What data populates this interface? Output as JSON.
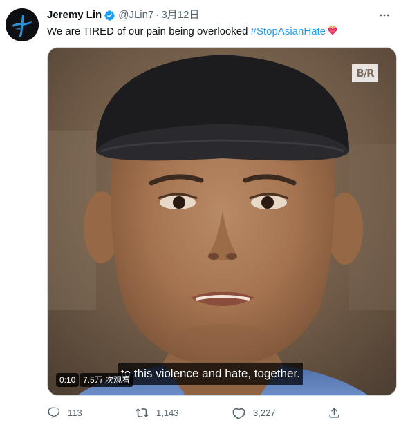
{
  "tweet": {
    "author_name": "Jeremy Lin",
    "handle": "@JLin7",
    "separator": "·",
    "date": "3月12日",
    "text_prefix": "We are TIRED of our pain being overlooked ",
    "hashtag": "#StopAsianHate",
    "emoji": "heart-on-fire"
  },
  "media": {
    "watermark": "B/R",
    "caption": "to this violence and hate, together.",
    "duration": "0:10",
    "views": "7.5万 次观看"
  },
  "actions": {
    "replies": "113",
    "retweets": "1,143",
    "likes": "3,227"
  },
  "icons": {
    "verified": "verified-badge-icon",
    "more": "more-options-icon",
    "reply": "reply-icon",
    "retweet": "retweet-icon",
    "like": "like-icon",
    "share": "share-icon"
  },
  "colors": {
    "accent": "#1d9bf0",
    "text": "#0f1419",
    "secondary": "#536471"
  }
}
